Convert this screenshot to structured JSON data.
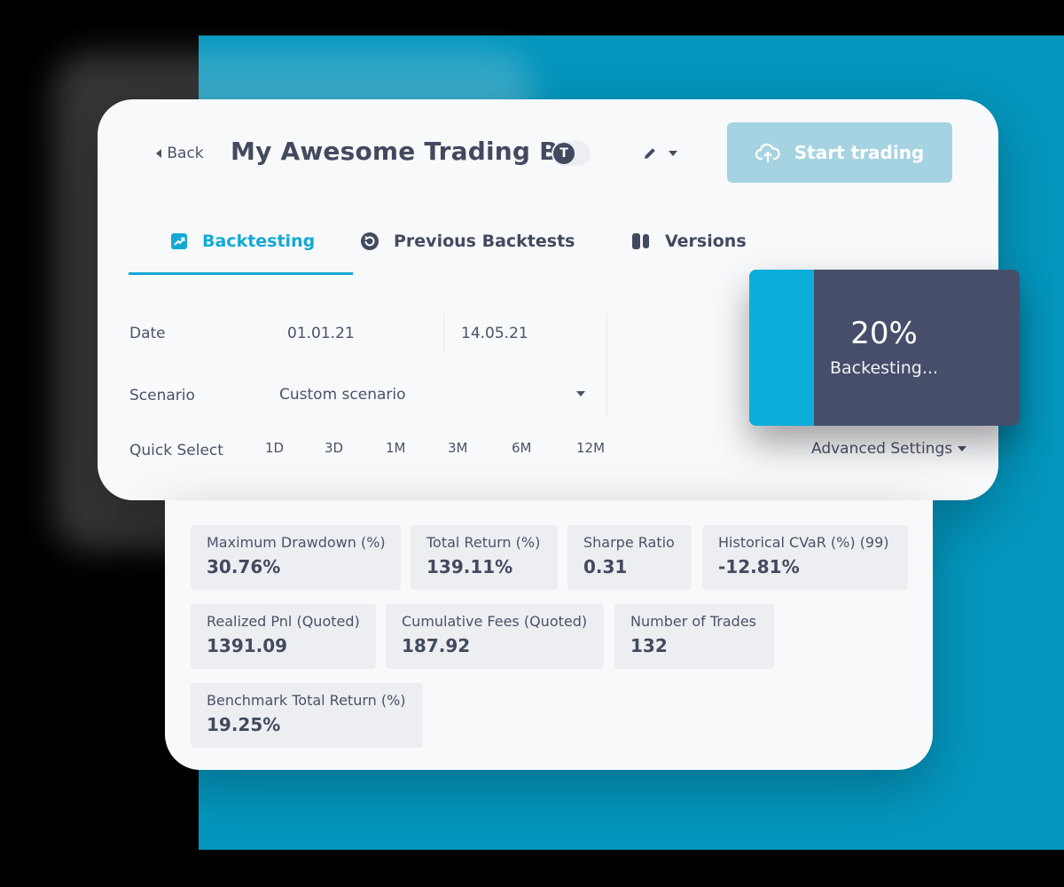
{
  "header": {
    "back_label": "Back",
    "bot_title": "My Awesome Trading Bot",
    "token_letter": "T",
    "start_label": "Start trading"
  },
  "tabs": [
    {
      "label": "Backtesting",
      "active": true,
      "icon": "chart-up-icon"
    },
    {
      "label": "Previous Backtests",
      "active": false,
      "icon": "history-icon"
    },
    {
      "label": "Versions",
      "active": false,
      "icon": "versions-icon"
    }
  ],
  "form": {
    "date_label": "Date",
    "date_from": "01.01.21",
    "date_to": "14.05.21",
    "scenario_label": "Scenario",
    "scenario_value": "Custom scenario",
    "quick_select_label": "Quick Select",
    "quick_options": [
      "1D",
      "3D",
      "1M",
      "3M",
      "6M",
      "12M"
    ],
    "advanced_label": "Advanced Settings"
  },
  "progress": {
    "percent_text": "20%",
    "fraction": 0.24,
    "status": "Backesting..."
  },
  "metrics": [
    {
      "label": "Maximum Drawdown (%)",
      "value": "30.76%"
    },
    {
      "label": "Total Return (%)",
      "value": "139.11%"
    },
    {
      "label": "Sharpe Ratio",
      "value": "0.31"
    },
    {
      "label": "Historical CVaR (%) (99)",
      "value": "-12.81%"
    },
    {
      "label": "Realized Pnl (Quoted)",
      "value": "1391.09"
    },
    {
      "label": "Cumulative Fees (Quoted)",
      "value": "187.92"
    },
    {
      "label": "Number of Trades",
      "value": "132"
    },
    {
      "label": "Benchmark Total Return (%)",
      "value": "19.25%"
    }
  ],
  "colors": {
    "accent": "#13a9d4",
    "background_teal": "#0496bd",
    "progress_dark": "#464e6a",
    "start_button": "#a6d3e1"
  }
}
